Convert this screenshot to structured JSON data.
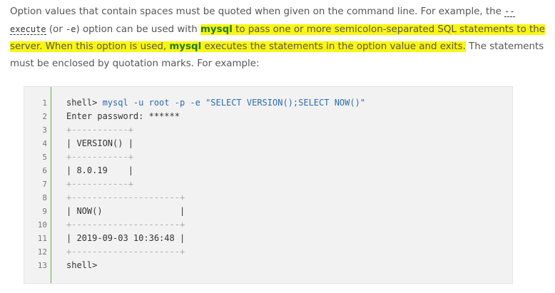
{
  "paragraph": {
    "p1": "Option values that contain spaces must be quoted when given on the command line. For example, the ",
    "opt_execute": "--execute",
    "p2": " (or ",
    "opt_e": "-e",
    "p3": ") option can be used with ",
    "mysql1": "mysql",
    "p4_hl": " to pass one or more semicolon-separated SQL statements to the server. When this option is used, ",
    "mysql2": "mysql",
    "p5_hl": " executes the statements in the option value and exits.",
    "p6": " The statements must be enclosed by quotation marks. For example:"
  },
  "code": {
    "line_numbers": [
      "1",
      "2",
      "3",
      "4",
      "5",
      "6",
      "7",
      "8",
      "9",
      "10",
      "11",
      "12",
      "13"
    ],
    "lines": {
      "l1_prompt": "shell> ",
      "l1_cmd": "mysql -u root -p -e ",
      "l1_str": "\"SELECT VERSION();SELECT NOW()\"",
      "l2_label": "Enter password: ",
      "l2_mask": "******",
      "l3": "+-----------+",
      "l4": "| VERSION() |",
      "l5": "+-----------+",
      "l6": "| 8.0.19    |",
      "l7": "+-----------+",
      "l8": "+---------------------+",
      "l9": "| NOW()               |",
      "l10": "+---------------------+",
      "l11": "| 2019-09-03 10:36:48 |",
      "l12": "+---------------------+",
      "l13": "shell>"
    }
  }
}
